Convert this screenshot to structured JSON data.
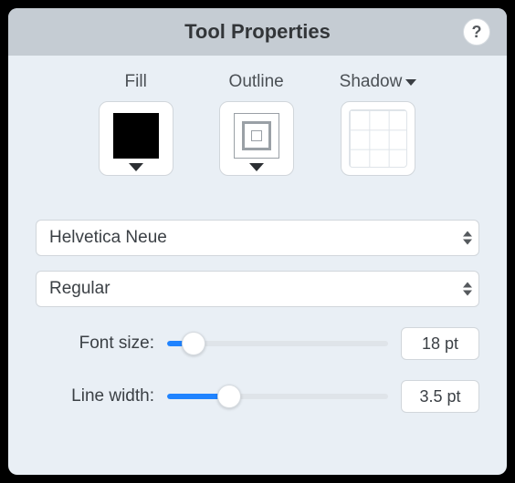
{
  "header": {
    "title": "Tool Properties",
    "help_label": "?"
  },
  "swatches": {
    "fill": {
      "label": "Fill"
    },
    "outline": {
      "label": "Outline"
    },
    "shadow": {
      "label": "Shadow"
    }
  },
  "font": {
    "family": "Helvetica Neue",
    "style": "Regular"
  },
  "sliders": {
    "font_size": {
      "label": "Font size:",
      "value_display": "18 pt",
      "percent": 12
    },
    "line_width": {
      "label": "Line width:",
      "value_display": "3.5 pt",
      "percent": 28
    }
  }
}
